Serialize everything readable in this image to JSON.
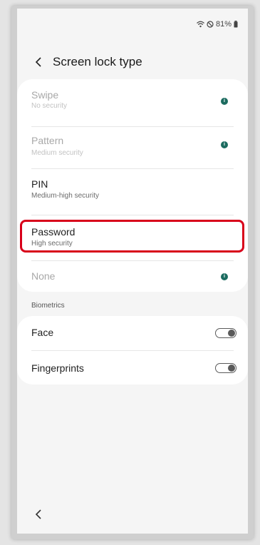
{
  "status_bar": {
    "battery": "81%",
    "icons": [
      "wifi-icon",
      "dnd-icon",
      "battery-icon"
    ]
  },
  "header": {
    "title": "Screen lock type",
    "back_icon": "chevron-left-icon"
  },
  "lock_options": [
    {
      "label": "Swipe",
      "sub": "No security",
      "enabled": false,
      "info": true
    },
    {
      "label": "Pattern",
      "sub": "Medium security",
      "enabled": false,
      "info": true
    },
    {
      "label": "PIN",
      "sub": "Medium-high security",
      "enabled": true,
      "info": false
    },
    {
      "label": "Password",
      "sub": "High security",
      "enabled": true,
      "info": false,
      "highlighted": true
    },
    {
      "label": "None",
      "sub": "",
      "enabled": false,
      "info": true
    }
  ],
  "biometrics": {
    "section_label": "Biometrics",
    "items": [
      {
        "label": "Face",
        "toggle": false
      },
      {
        "label": "Fingerprints",
        "toggle": false
      }
    ]
  },
  "nav": {
    "back_icon": "chevron-left-icon"
  },
  "colors": {
    "highlight": "#d8001a",
    "info_dot": "#1b6b5f"
  }
}
